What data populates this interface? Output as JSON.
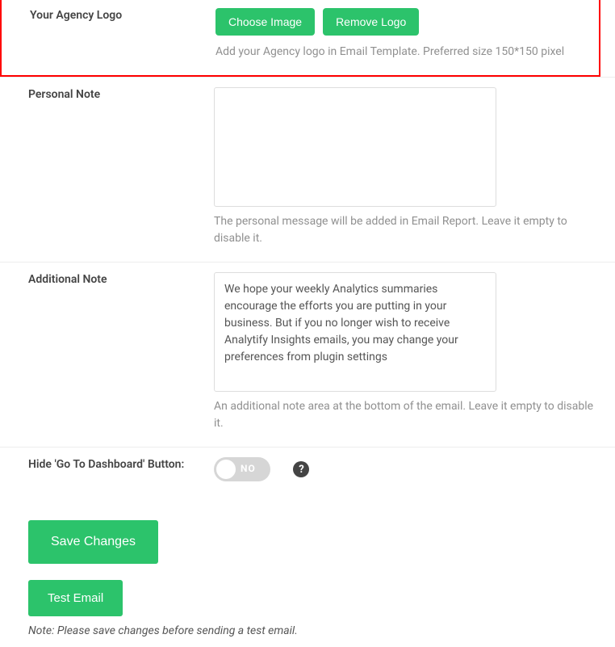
{
  "logo": {
    "label": "Your Agency Logo",
    "choose_btn": "Choose Image",
    "remove_btn": "Remove Logo",
    "help": "Add your Agency logo in Email Template. Preferred size 150*150 pixel"
  },
  "personal_note": {
    "label": "Personal Note",
    "value": "",
    "help": "The personal message will be added in Email Report. Leave it empty to disable it."
  },
  "additional_note": {
    "label": "Additional Note",
    "value": "We hope your weekly Analytics summaries encourage the efforts you are putting in your business. But if you no longer wish to receive Analytify Insights emails, you may change your preferences from plugin settings",
    "help": "An additional note area at the bottom of the email. Leave it empty to disable it."
  },
  "hide_dashboard": {
    "label": "Hide 'Go To Dashboard' Button:",
    "toggle_text": "NO",
    "help_icon": "?"
  },
  "actions": {
    "save": "Save Changes",
    "test": "Test Email",
    "note": "Note: Please save changes before sending a test email."
  }
}
